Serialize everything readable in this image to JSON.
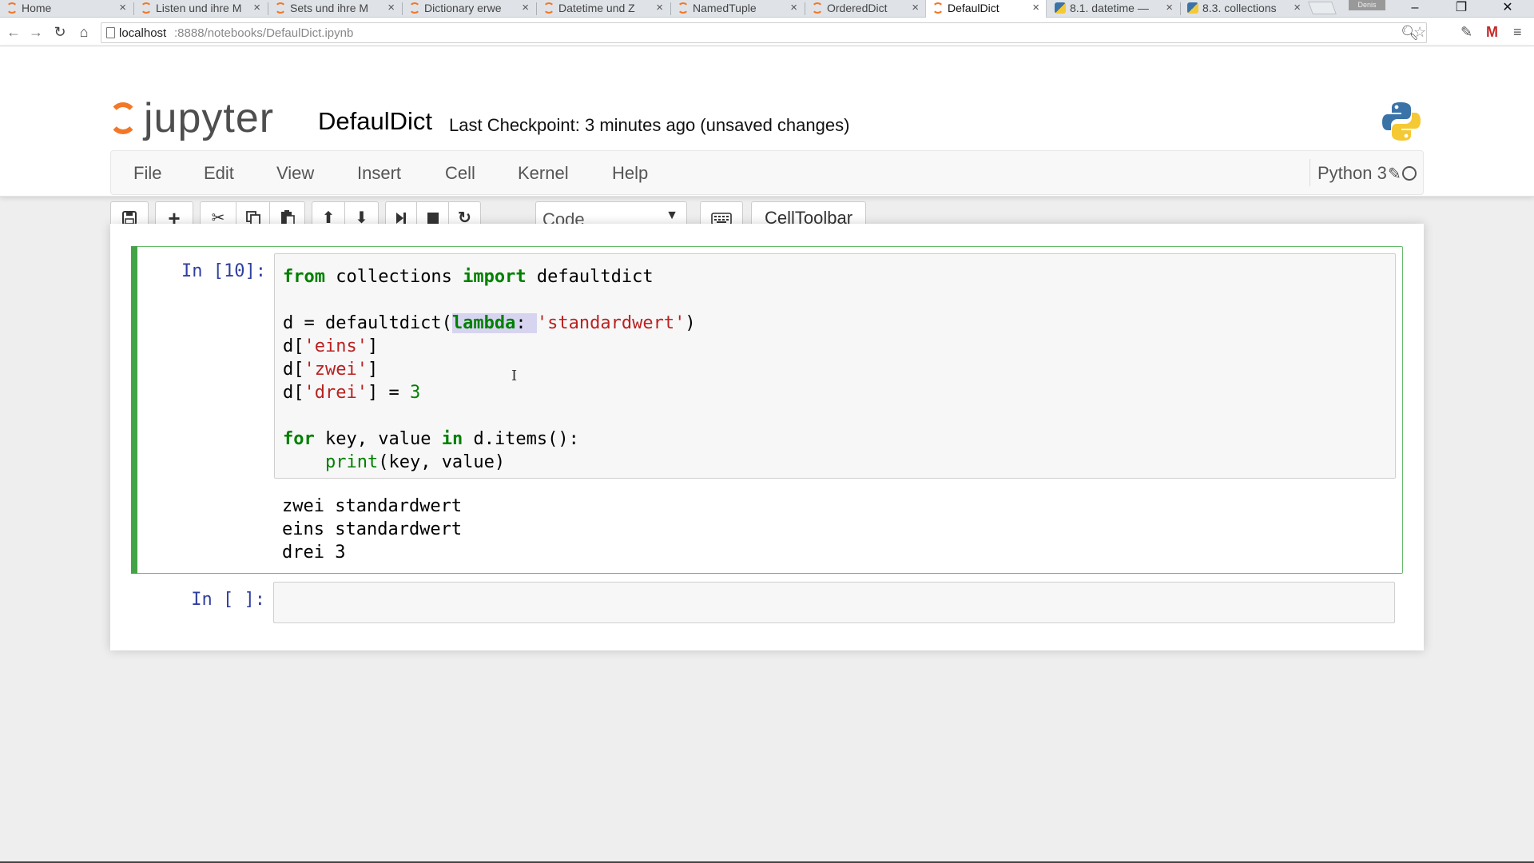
{
  "browser": {
    "tabs": [
      {
        "title": "Home",
        "icon": "jupyter-icon",
        "active": false
      },
      {
        "title": "Listen und ihre M",
        "icon": "jupyter-icon",
        "active": false
      },
      {
        "title": "Sets und ihre M",
        "icon": "jupyter-icon",
        "active": false
      },
      {
        "title": "Dictionary erwe",
        "icon": "jupyter-icon",
        "active": false
      },
      {
        "title": "Datetime und Z",
        "icon": "jupyter-icon",
        "active": false
      },
      {
        "title": "NamedTuple",
        "icon": "jupyter-icon",
        "active": false
      },
      {
        "title": "OrderedDict",
        "icon": "jupyter-icon",
        "active": false
      },
      {
        "title": "DefaulDict",
        "icon": "jupyter-icon",
        "active": true
      },
      {
        "title": "8.1. datetime —",
        "icon": "python-icon",
        "active": false
      },
      {
        "title": "8.3. collections",
        "icon": "python-icon",
        "active": false
      }
    ],
    "profile_label": "Denis",
    "url_host": "localhost",
    "url_path": ":8888/notebooks/DefaulDict.ipynb"
  },
  "header": {
    "logo_text": "jupyter",
    "notebook_name": "DefaulDict",
    "checkpoint": "Last Checkpoint: 3 minutes ago (unsaved changes)"
  },
  "menu": {
    "items": [
      "File",
      "Edit",
      "View",
      "Insert",
      "Cell",
      "Kernel",
      "Help"
    ],
    "kernel_name": "Python 3"
  },
  "toolbar": {
    "cell_type": "Code",
    "celltoolbar_label": "CellToolbar"
  },
  "cells": [
    {
      "prompt": "In [10]:",
      "code_lines": [
        "from collections import defaultdict",
        "",
        "d = defaultdict(lambda: 'standardwert')",
        "d['eins']",
        "d['zwei']",
        "d['drei'] = 3",
        "",
        "for key, value in d.items():",
        "    print(key, value)"
      ],
      "output_lines": [
        "zwei standardwert",
        "eins standardwert",
        "drei 3"
      ]
    },
    {
      "prompt": "In [ ]:",
      "code_lines": [],
      "output_lines": []
    }
  ],
  "colors": {
    "jupyter_orange": "#f37726",
    "cell_selected_green": "#42a447",
    "prompt_blue": "#303f9f",
    "keyword_green": "#008000",
    "string_red": "#ba2121"
  }
}
